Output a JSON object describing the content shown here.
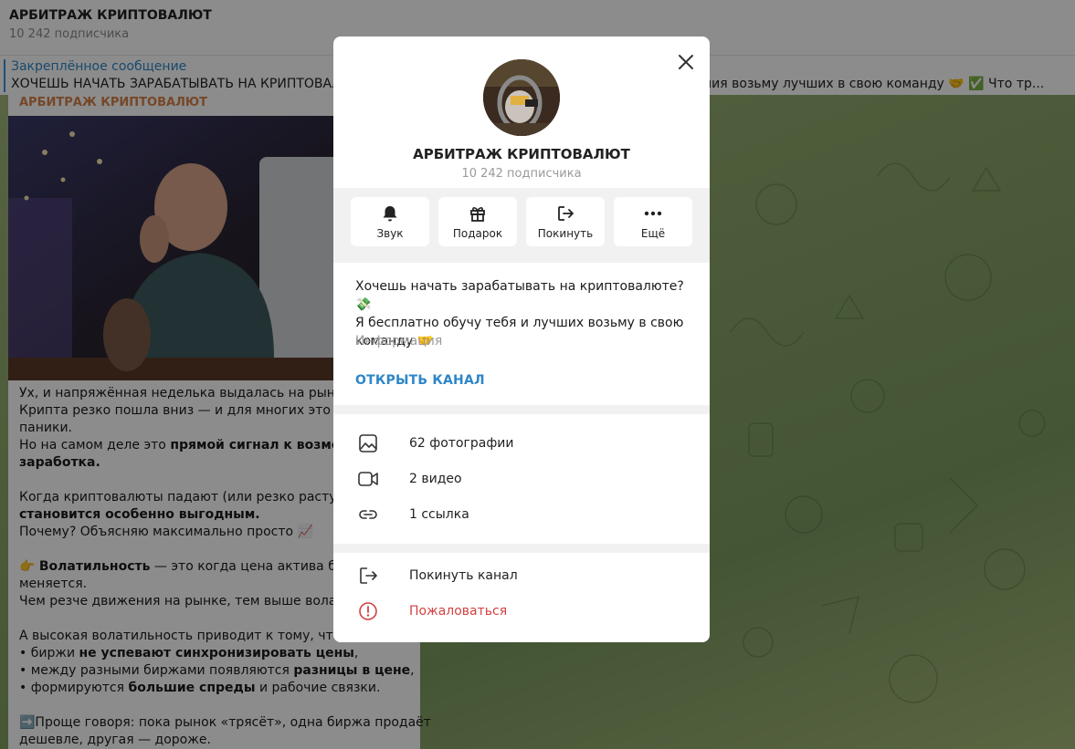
{
  "header": {
    "title": "АРБИТРАЖ КРИПТОВАЛЮТ",
    "subscribers": "10 242 подписчика"
  },
  "pinned": {
    "title": "Закреплённое сообщение",
    "text_left": "ХОЧЕШЬ НАЧАТЬ ЗАРАБАТЫВАТЬ НА КРИПТОВАЛЮ",
    "text_right": "обучения возьму лучших в свою команду 🤝 ✅ Что тр..."
  },
  "post": {
    "author": "АРБИТРАЖ КРИПТОВАЛЮТ",
    "lines": [
      {
        "text": "Ух, и напряжённая неделька выдалась на рынке"
      },
      {
        "text": "Крипта резко пошла вниз — и для многих это пов"
      },
      {
        "text": "паники."
      },
      {
        "text": "Но на самом деле это ",
        "bold": "прямой сигнал к возможно"
      },
      {
        "bold": "заработка."
      },
      {
        "text": ""
      },
      {
        "text": "Когда криптовалюты падают (или резко растут), а"
      },
      {
        "bold": "становится особенно выгодным."
      },
      {
        "text": "Почему? Объясняю максимально просто 📈"
      },
      {
        "text": ""
      },
      {
        "text": "👉 ",
        "bold": "Волатильность",
        "after": " — это когда цена актива быст"
      },
      {
        "text": "меняется."
      },
      {
        "text": "Чем резче движения на рынке, тем выше волати"
      },
      {
        "text": ""
      },
      {
        "text": "А высокая волатильность приводит к тому, что:"
      },
      {
        "text": " • биржи ",
        "bold": "не успевают синхронизировать цены",
        "after": ","
      },
      {
        "text": " • между разными биржами появляются ",
        "bold": "разницы в цене",
        "after": ","
      },
      {
        "text": " • формируются ",
        "bold": "большие спреды",
        "after": " и рабочие связки."
      },
      {
        "text": ""
      },
      {
        "text": "➡️Проще говоря: пока рынок «трясёт», одна биржа продаёт"
      },
      {
        "text": "дешевле, другая — дороже."
      }
    ]
  },
  "modal": {
    "title": "АРБИТРАЖ КРИПТОВАЛЮТ",
    "subscribers": "10 242 подписчика",
    "actions": [
      {
        "label": "Звук",
        "icon": "bell-icon"
      },
      {
        "label": "Подарок",
        "icon": "gift-icon"
      },
      {
        "label": "Покинуть",
        "icon": "leave-icon"
      },
      {
        "label": "Ещё",
        "icon": "more-icon"
      }
    ],
    "about_lines": [
      "Хочешь начать зарабатывать на криптовалюте? 💸",
      "Я бесплатно обучу тебя и лучших возьму в свою",
      "команду 🤝"
    ],
    "about_label": "Информация",
    "open_channel": "ОТКРЫТЬ КАНАЛ",
    "media": [
      {
        "label": "62 фотографии",
        "icon": "photo-icon"
      },
      {
        "label": "2 видео",
        "icon": "video-icon"
      },
      {
        "label": "1 ссылка",
        "icon": "link-icon"
      }
    ],
    "leave": "Покинуть канал",
    "report": "Пожаловаться"
  },
  "colors": {
    "accent": "#2f86c7",
    "danger": "#d24141",
    "author": "#d7824a"
  }
}
